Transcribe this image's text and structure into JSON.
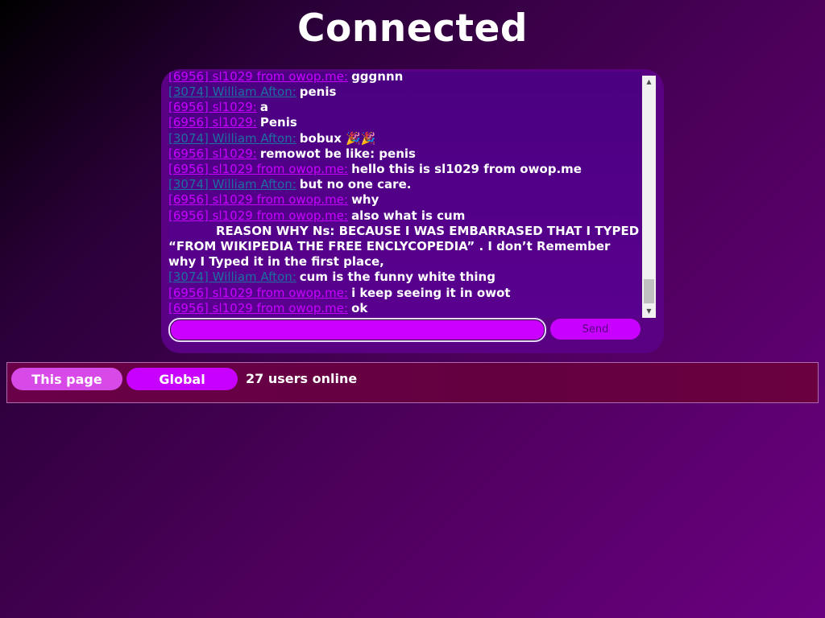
{
  "page": {
    "title": "Connected"
  },
  "chat": {
    "messages": [
      {
        "nick": "[6956] sl1029 from owop.me:",
        "text": "gggnnn",
        "color": "magenta"
      },
      {
        "nick": "[3074] William Afton:",
        "text": "penis",
        "color": "teal"
      },
      {
        "nick": "[6956] sl1029:",
        "text": "a",
        "color": "magenta"
      },
      {
        "nick": "[6956] sl1029:",
        "text": "Penis",
        "color": "magenta"
      },
      {
        "nick": "[3074] William Afton:",
        "text": "bobux 🎉🎉",
        "color": "teal"
      },
      {
        "nick": "[6956] sl1029:",
        "text": "remowot be like: penis",
        "color": "magenta"
      },
      {
        "nick": "[6956] sl1029 from owop.me:",
        "text": "hello this is sl1029 from owop.me",
        "color": "magenta"
      },
      {
        "nick": "[3074] William Afton:",
        "text": "but no one care.",
        "color": "teal"
      },
      {
        "nick": "[6956] sl1029 from owop.me:",
        "text": "why",
        "color": "magenta"
      },
      {
        "nick": "[6956] sl1029 from owop.me:",
        "text": "also what is cum",
        "color": "magenta"
      },
      {
        "nick": "",
        "text": "REASON WHY Ns: BECAUSE I WAS EMBARRASED THAT I TYPED “FROM WIKIPEDIA THE FREE ENCLYCOPEDIA” . I don’t Remember why I Typed it in the first place,",
        "color": ""
      },
      {
        "nick": "[3074] William Afton:",
        "text": "cum is the funny white thing",
        "color": "teal"
      },
      {
        "nick": "[6956] sl1029 from owop.me:",
        "text": "i keep seeing it in owot",
        "color": "magenta"
      },
      {
        "nick": "[6956] sl1029 from owop.me:",
        "text": "ok",
        "color": "magenta"
      }
    ],
    "input_value": "",
    "send_label": "Send"
  },
  "status": {
    "tab_this_page": "This page",
    "tab_global": "Global",
    "users_online": "27 users online"
  },
  "colors": {
    "magenta_nick": "#c800ff",
    "teal_nick": "#1d6fa0",
    "panel": "#5a0083",
    "accent": "#c800ff"
  }
}
